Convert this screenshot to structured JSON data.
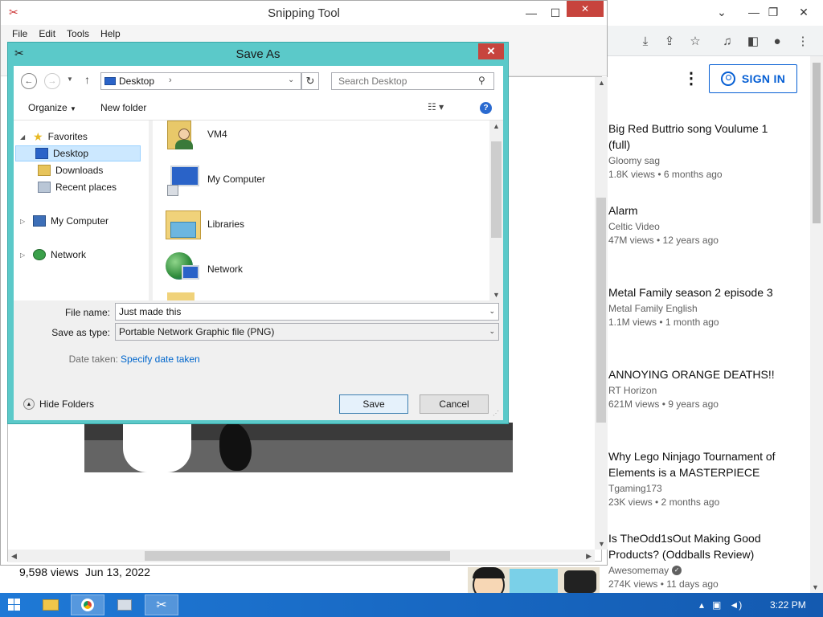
{
  "browser": {
    "signin_label": "SIGN IN",
    "videos": [
      {
        "title": "Big Red Buttrio song Voulume 1 (full)",
        "channel": "Gloomy sag",
        "meta": "1.8K views  •  6 months ago",
        "verified": false
      },
      {
        "title": "Alarm",
        "channel": "Celtic Video",
        "meta": "47M views  •  12 years ago",
        "verified": false
      },
      {
        "title": "Metal Family season 2 episode 3",
        "channel": "Metal Family English",
        "meta": "1.1M views  •  1 month ago",
        "verified": false
      },
      {
        "title": "ANNOYING ORANGE DEATHS!!",
        "channel": "RT Horizon",
        "meta": "621M views  •  9 years ago",
        "verified": false
      },
      {
        "title": "Why Lego Ninjago Tournament of Elements is a MASTERPIECE",
        "channel": "Tgaming173",
        "meta": "23K views  •  2 months ago",
        "verified": false
      },
      {
        "title": "Is TheOdd1sOut Making Good Products? (Oddballs Review)",
        "channel": "Awesomemay",
        "meta": "274K views  •  11 days ago",
        "verified": true
      }
    ]
  },
  "snipping_tool": {
    "title": "Snipping Tool",
    "menu": [
      "File",
      "Edit",
      "Tools",
      "Help"
    ],
    "views_label": "9,598 views",
    "date_label": "Jun 13, 2022"
  },
  "dialog": {
    "title": "Save As",
    "address": "Desktop",
    "search_placeholder": "Search Desktop",
    "organize_label": "Organize",
    "new_folder_label": "New folder",
    "tree": {
      "favorites": "Favorites",
      "desktop": "Desktop",
      "downloads": "Downloads",
      "recent": "Recent places",
      "my_computer": "My Computer",
      "network": "Network"
    },
    "files": [
      "VM4",
      "My Computer",
      "Libraries",
      "Network"
    ],
    "file_name_label": "File name:",
    "file_name_value": "Just made this",
    "save_type_label": "Save as type:",
    "save_type_value": "Portable Network Graphic file (PNG)",
    "date_taken_label": "Date taken:",
    "date_taken_link": "Specify date taken",
    "hide_folders_label": "Hide Folders",
    "save_label": "Save",
    "cancel_label": "Cancel"
  },
  "taskbar": {
    "clock": "3:22 PM"
  },
  "colors": {
    "dialog_frame": "#5bc9c9",
    "taskbar": "#1a6bc6",
    "link": "#0066cc",
    "youtube_blue": "#065fd4",
    "close_red": "#c7443d"
  }
}
